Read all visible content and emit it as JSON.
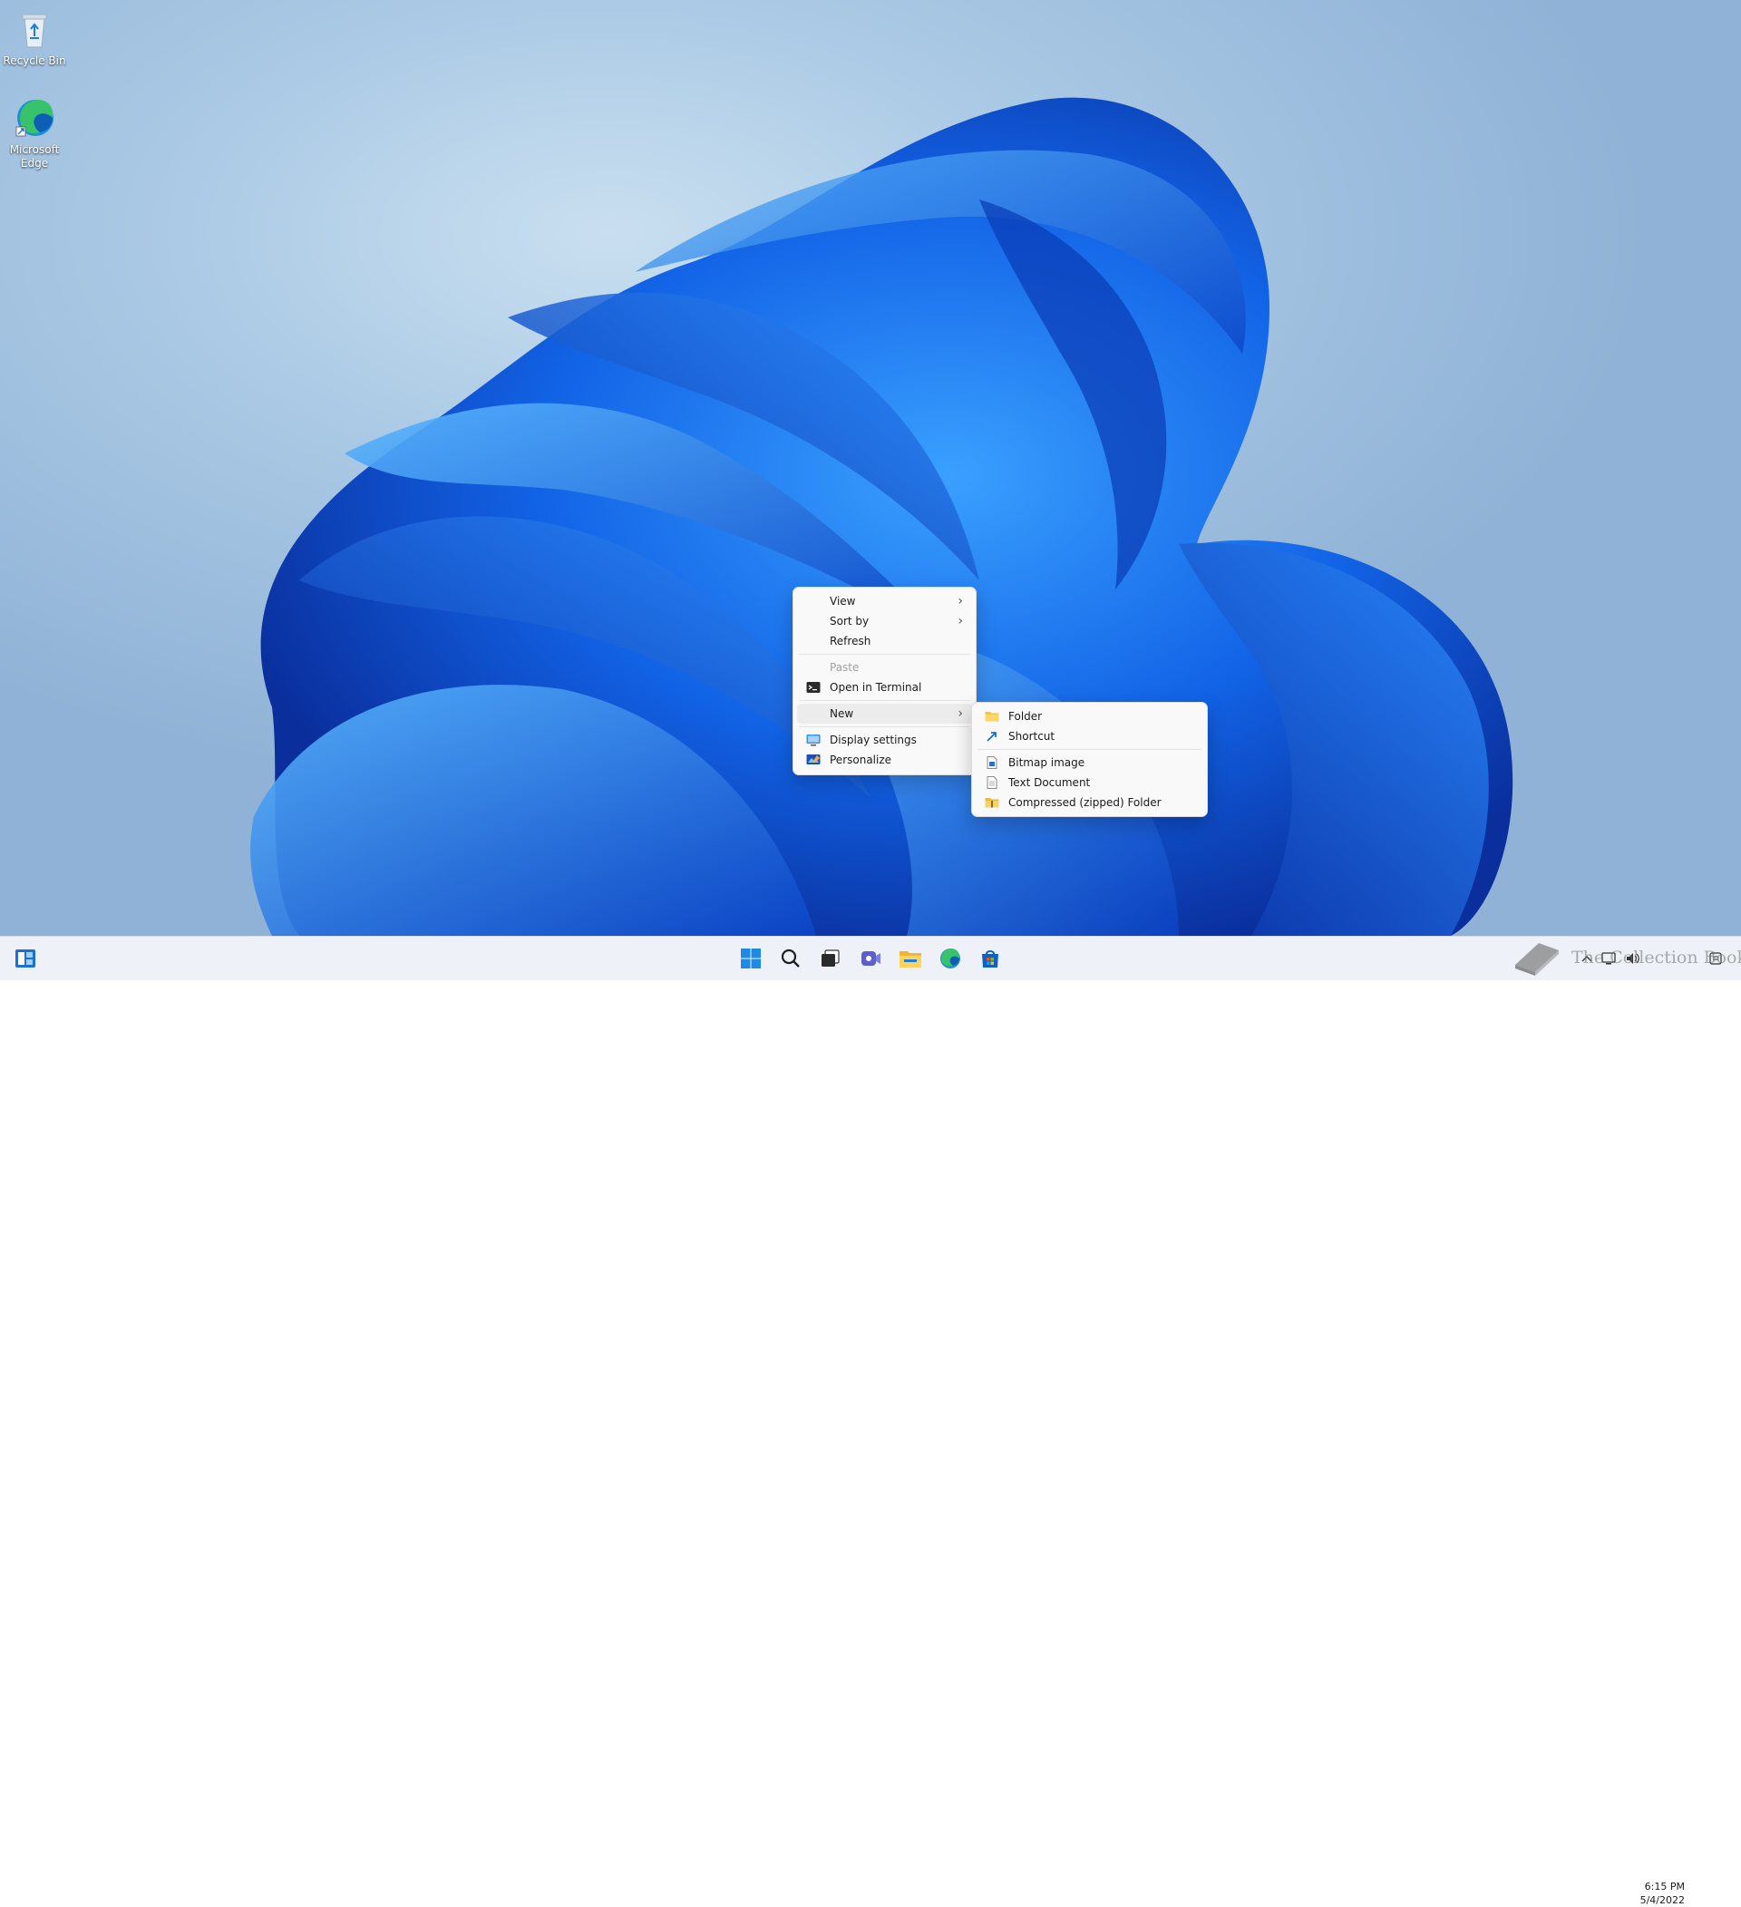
{
  "desktop": {
    "icons": [
      {
        "label": "Recycle Bin",
        "icon": "recycle-bin-icon"
      },
      {
        "label": "Microsoft Edge",
        "icon": "edge-icon"
      }
    ]
  },
  "context_menu": {
    "items": [
      {
        "label": "View",
        "has_submenu": true
      },
      {
        "label": "Sort by",
        "has_submenu": true
      },
      {
        "label": "Refresh"
      },
      {
        "label": "Paste",
        "disabled": true
      },
      {
        "label": "Open in Terminal",
        "icon": "terminal-icon"
      },
      {
        "label": "New",
        "has_submenu": true,
        "highlighted": true
      },
      {
        "label": "Display settings",
        "icon": "display-icon"
      },
      {
        "label": "Personalize",
        "icon": "personalize-icon"
      }
    ]
  },
  "new_submenu": {
    "items": [
      {
        "label": "Folder",
        "icon": "folder-icon"
      },
      {
        "label": "Shortcut",
        "icon": "shortcut-icon"
      },
      {
        "label": "Bitmap image",
        "icon": "bitmap-icon"
      },
      {
        "label": "Text Document",
        "icon": "text-document-icon"
      },
      {
        "label": "Compressed (zipped) Folder",
        "icon": "zip-folder-icon"
      }
    ]
  },
  "taskbar": {
    "apps": [
      "start-icon",
      "search-icon",
      "task-view-icon",
      "chat-icon",
      "file-explorer-icon",
      "edge-icon",
      "store-icon"
    ],
    "left_widget": "widgets-icon",
    "tray": [
      "chevron-up-icon",
      "network-icon",
      "volume-icon"
    ],
    "clock": {
      "time": "6:15 PM",
      "date": "5/4/2022"
    }
  },
  "watermark": {
    "text": "The Collection Book"
  },
  "colors": {
    "accent": "#0067c0",
    "taskbar": "#eef2f8",
    "menu_bg": "#f9f9f9"
  }
}
